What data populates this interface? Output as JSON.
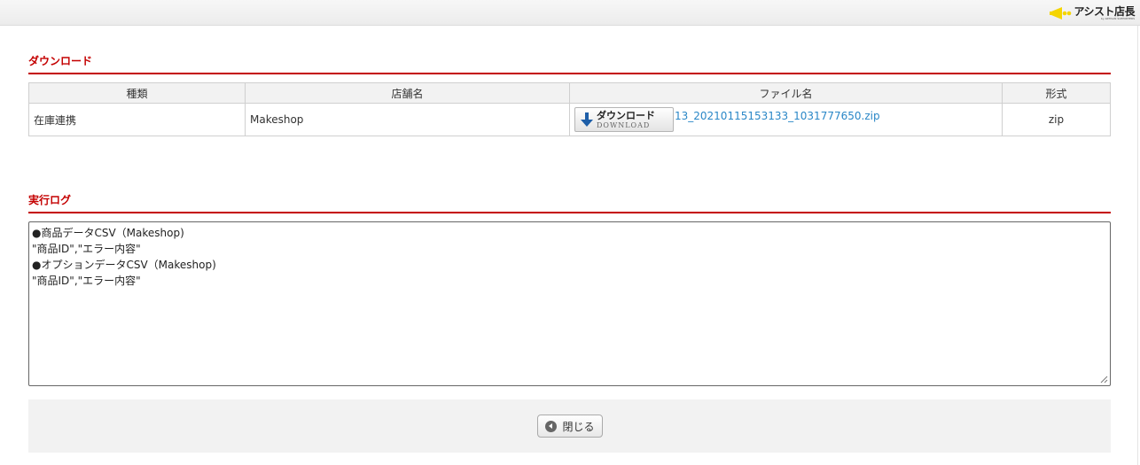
{
  "header": {
    "logo_text": "アシスト店長",
    "logo_sub": "by ARTISAN SUPPORTERS",
    "logo_color": "#f5d500"
  },
  "download_section": {
    "title": "ダウンロード",
    "columns": [
      "種類",
      "店舗名",
      "ファイル名",
      "形式"
    ],
    "row": {
      "type": "在庫連携",
      "shop": "Makeshop",
      "button_label": "ダウンロード",
      "button_sub": "DOWNLOAD",
      "file_name": "13_20210115153133_1031777650.zip",
      "format": "zip"
    }
  },
  "log_section": {
    "title": "実行ログ",
    "lines": [
      "●商品データCSV（Makeshop)",
      "\"商品ID\",\"エラー内容\"",
      "",
      "●オプションデータCSV（Makeshop)",
      "\"商品ID\",\"エラー内容\""
    ]
  },
  "footer": {
    "close_label": "閉じる"
  },
  "colors": {
    "accent": "#c40000",
    "link": "#2a87c7"
  }
}
